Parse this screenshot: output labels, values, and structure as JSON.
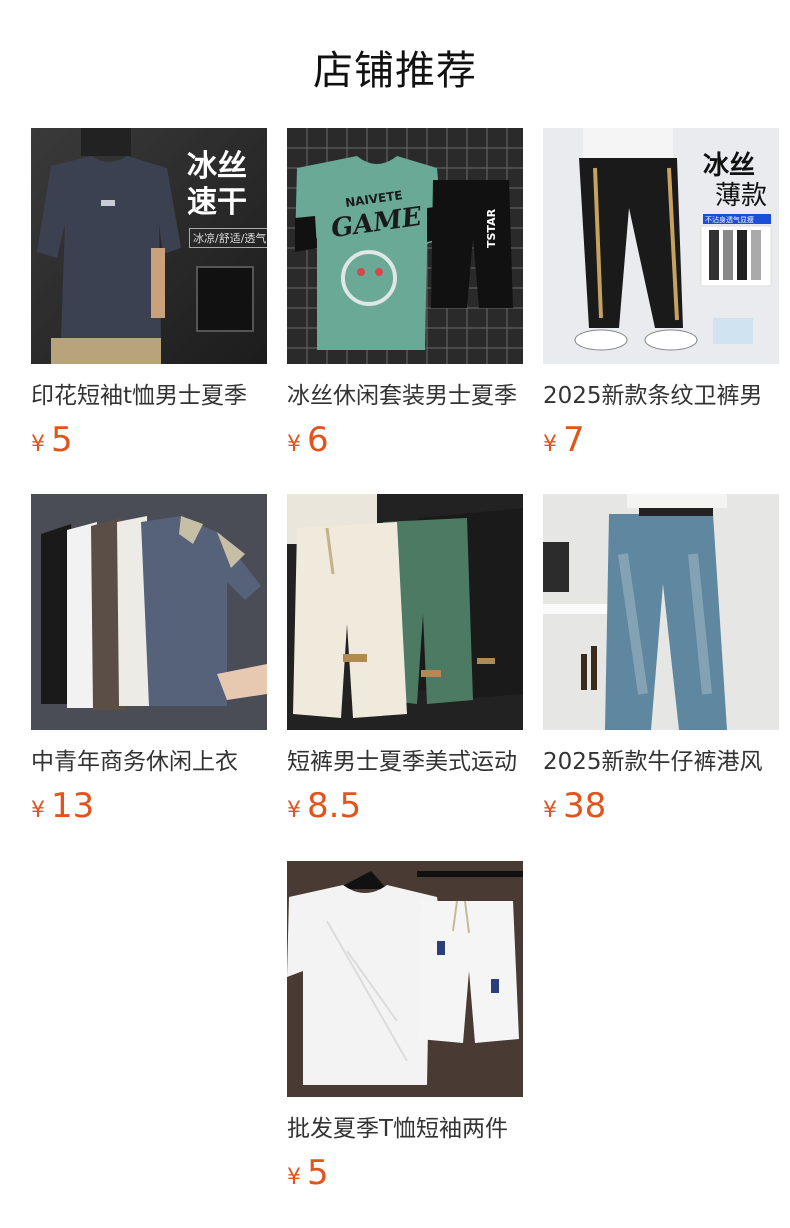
{
  "page": {
    "title": "店铺推荐"
  },
  "currency_symbol": "¥",
  "products": [
    {
      "name": "印花短袖t恤男士夏季",
      "price": "5",
      "image_text": {
        "line1": "冰丝",
        "line2": "速干",
        "sub": "冰凉/舒适/透气"
      },
      "image": "tshirt-dark-gray"
    },
    {
      "name": "冰丝休闲套装男士夏季",
      "price": "6",
      "image_text": {
        "shirt": "GAME",
        "shirt_top": "NAIVETE",
        "shorts": "TSTAR"
      },
      "image": "green-tshirt-black-shorts-set"
    },
    {
      "name": "2025新款条纹卫裤男",
      "price": "7",
      "image_text": {
        "line1": "冰丝",
        "line2": "薄款",
        "sub": "不沾身透气显瘦"
      },
      "image": "black-jogger-pants"
    },
    {
      "name": "中青年商务休闲上衣",
      "price": "13",
      "image": "polo-shirts-multiple-colors"
    },
    {
      "name": "短裤男士夏季美式运动",
      "price": "8.5",
      "image": "waffle-shorts-three-colors"
    },
    {
      "name": "2025新款牛仔裤港风",
      "price": "38",
      "image": "wide-leg-jeans"
    },
    {
      "name": "批发夏季T恤短袖两件",
      "price": "5",
      "image": "white-tshirt-shorts-set"
    }
  ],
  "colors": {
    "price": "#e2541b",
    "title": "#111111"
  }
}
